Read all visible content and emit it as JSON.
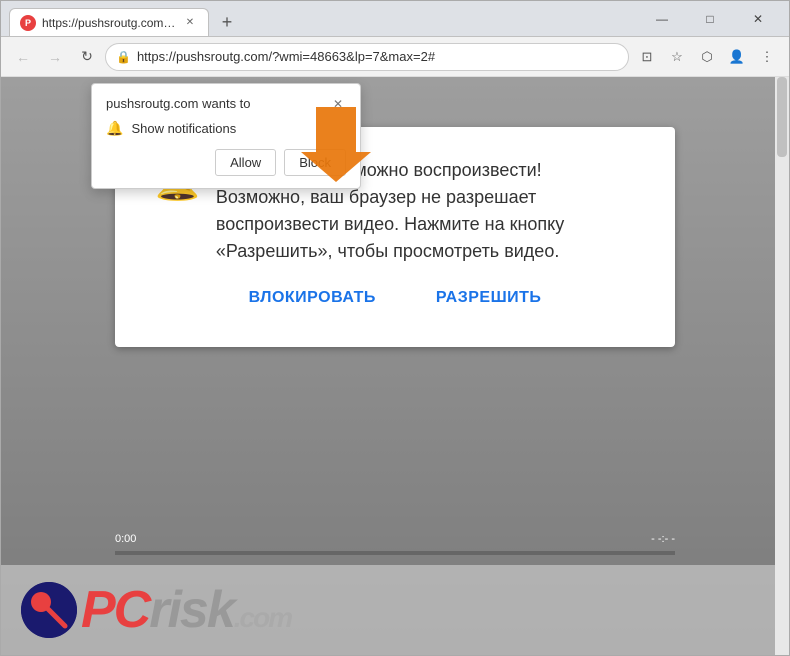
{
  "browser": {
    "tab": {
      "title": "https://pushsroutg.com/?wmi=4...",
      "icon_label": "P"
    },
    "new_tab_label": "+",
    "window_controls": {
      "minimize": "—",
      "maximize": "□",
      "close": "✕"
    },
    "address_bar": {
      "url": "https://pushsroutg.com/?wmi=48663&lp=7&max=2#",
      "lock_symbol": "🔒"
    },
    "nav": {
      "back": "←",
      "forward": "→",
      "refresh": "↻"
    },
    "toolbar_icons": {
      "cast": "⊡",
      "bookmark": "★",
      "extensions": "⬡",
      "account": "👤",
      "menu": "⋮"
    }
  },
  "notification_popup": {
    "site_text": "pushsroutg.com wants to",
    "permission_text": "Show notifications",
    "allow_label": "Allow",
    "block_label": "Block",
    "close_symbol": "✕"
  },
  "page_content": {
    "video_message": "Это видео невозможно воспроизвести! Возможно, ваш браузер не разрешает воспроизвести видео. Нажмите на кнопку «Разрешить», чтобы просмотреть видео.",
    "btn_block": "ВЛОКИРОВАТЬ",
    "btn_allow": "РАЗРЕШИТЬ",
    "time_left": "0:00",
    "time_right": "- -:- -"
  },
  "pcrisk": {
    "text_pc": "PC",
    "text_risk": "risk",
    "text_domain": ".com"
  },
  "colors": {
    "accent_blue": "#1a73e8",
    "tab_bg": "#ffffff",
    "chrome_bg": "#f2f2f2",
    "pcrisk_red": "#e84040"
  }
}
